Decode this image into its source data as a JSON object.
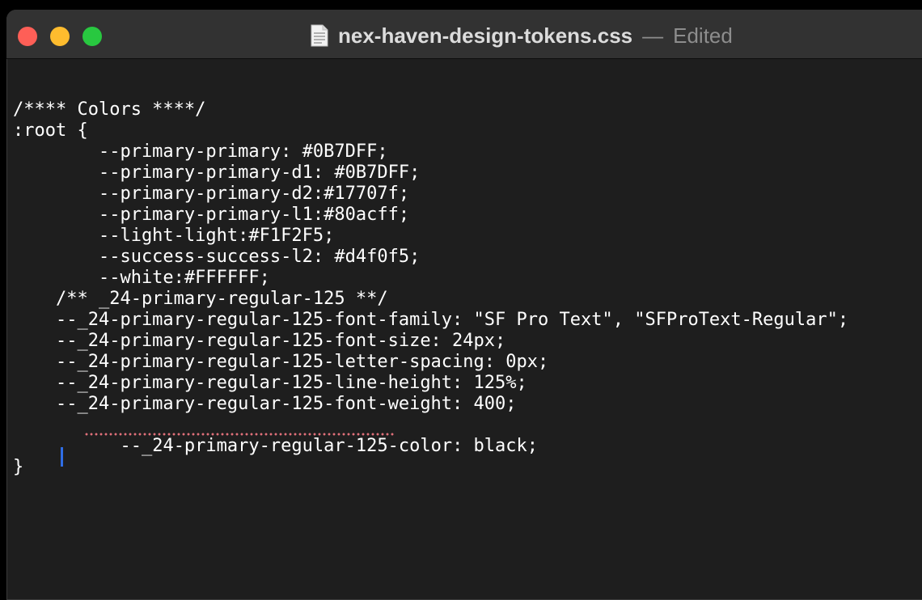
{
  "window": {
    "title": "nex-haven-design-tokens.css",
    "separator": "—",
    "status": "Edited"
  },
  "icons": {
    "document": "document-icon",
    "close": "close-button",
    "minimize": "minimize-button",
    "zoom": "zoom-button"
  },
  "colors": {
    "close": "#fe5f57",
    "minimize": "#febc2e",
    "zoom": "#28c840",
    "editor_background": "#1e1e1e",
    "text": "#ffffff",
    "caret": "#2f6de5",
    "spellcheck": "#e0707a"
  },
  "editor": {
    "lines": [
      "",
      "/**** Colors ****/",
      ":root {",
      "        --primary-primary: #0B7DFF;",
      "        --primary-primary-d1: #0B7DFF;",
      "        --primary-primary-d2:#17707f;",
      "        --primary-primary-l1:#80acff;",
      "        --light-light:#F1F2F5;",
      "        --success-success-l2: #d4f0f5;",
      "        --white:#FFFFFF;",
      "    /** _24-primary-regular-125 **/",
      "    --_24-primary-regular-125-font-family: \"SF Pro Text\", \"SFProText-Regular\";",
      "    --_24-primary-regular-125-font-size: 24px;",
      "    --_24-primary-regular-125-letter-spacing: 0px;",
      "    --_24-primary-regular-125-line-height: 125%;",
      "    --_24-primary-regular-125-font-weight: 400;",
      "    --_24-primary-regular-125-color: black;",
      "    ",
      "}"
    ]
  }
}
